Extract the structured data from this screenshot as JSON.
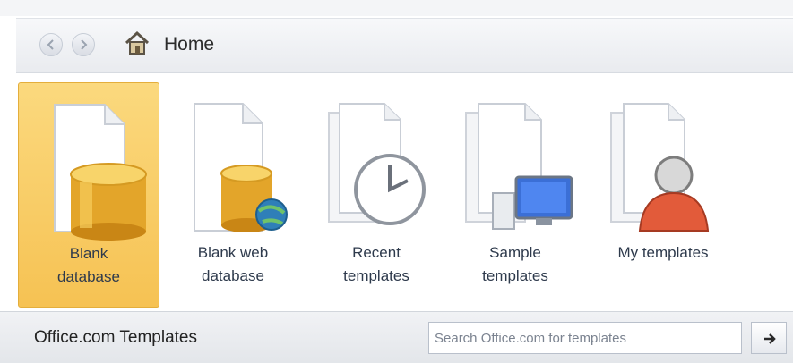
{
  "nav": {
    "back_icon": "back-arrow-icon",
    "forward_icon": "forward-arrow-icon",
    "home_icon": "home-icon",
    "title": "Home"
  },
  "tiles": [
    {
      "line1": "Blank",
      "line2": "database",
      "icon": "blank-database-icon",
      "selected": true
    },
    {
      "line1": "Blank web",
      "line2": "database",
      "icon": "blank-web-database-icon",
      "selected": false
    },
    {
      "line1": "Recent",
      "line2": "templates",
      "icon": "recent-templates-icon",
      "selected": false
    },
    {
      "line1": "Sample",
      "line2": "templates",
      "icon": "sample-templates-icon",
      "selected": false
    },
    {
      "line1": "My templates",
      "line2": "",
      "icon": "my-templates-icon",
      "selected": false
    }
  ],
  "office_section": {
    "title": "Office.com Templates",
    "search_placeholder": "Search Office.com for templates",
    "search_button_icon": "arrow-right-icon"
  },
  "colors": {
    "selected_tile": "#f6c253",
    "label_text": "#2e3a4c",
    "navbar_bg": "#eceef1"
  }
}
